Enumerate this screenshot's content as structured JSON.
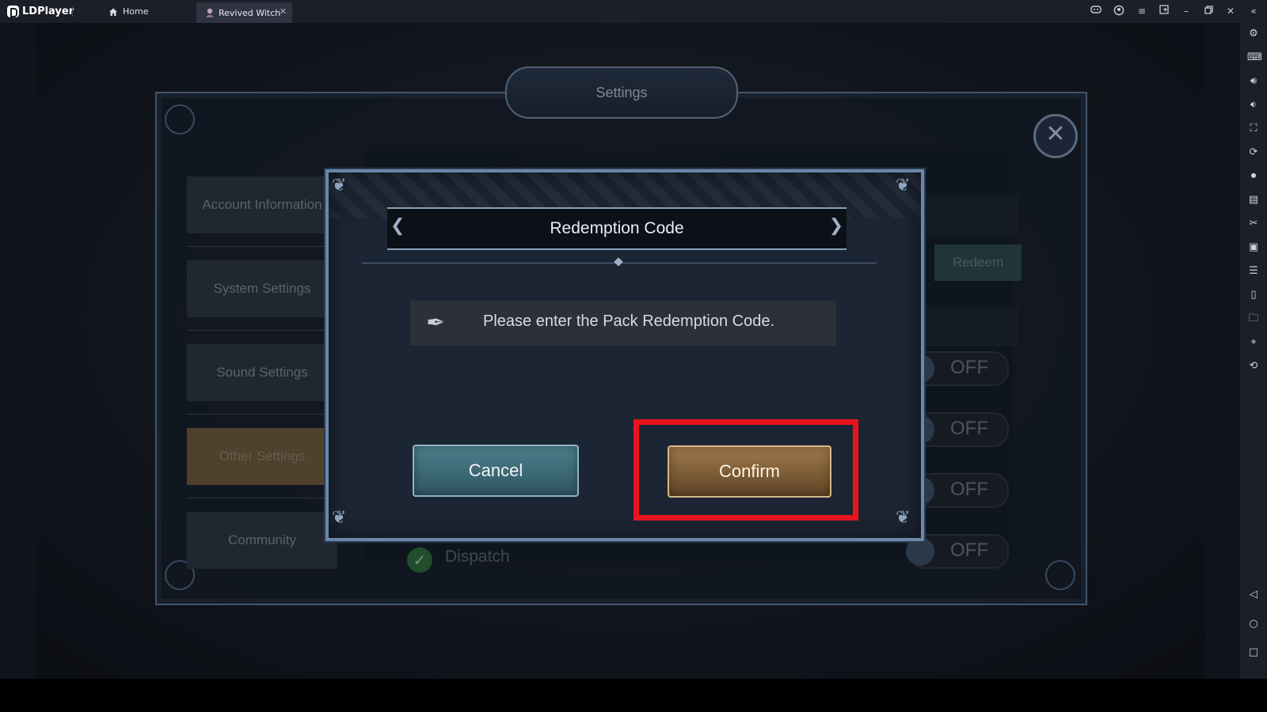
{
  "app": {
    "name": "LDPlayer",
    "tabs": [
      {
        "label": "Home",
        "icon": "home-icon"
      },
      {
        "label": "Revived Witch",
        "icon": "game-icon"
      }
    ],
    "window_controls": [
      "gamepad-icon",
      "account-icon",
      "menu-icon",
      "resize-icon",
      "minimize-icon",
      "restore-icon",
      "close-icon",
      "collapse-icon"
    ]
  },
  "sidebar": {
    "icons": [
      "settings-icon",
      "keyboard-icon",
      "volume-up-icon",
      "volume-down-icon",
      "screenshot-icon",
      "sync-icon",
      "record-icon",
      "apk-icon",
      "scissors-icon",
      "multi-instance-icon",
      "notes-icon",
      "shake-icon",
      "folder-icon",
      "location-icon",
      "rotate-icon"
    ],
    "nav_icons": [
      "back-icon",
      "home-circle-icon",
      "recents-icon"
    ]
  },
  "settings": {
    "title": "Settings",
    "close_label": "✕",
    "menu": [
      {
        "label": "Account Information",
        "active": false
      },
      {
        "label": "System Settings",
        "active": false
      },
      {
        "label": "Sound Settings",
        "active": false
      },
      {
        "label": "Other Settings",
        "active": true
      },
      {
        "label": "Community",
        "active": false
      }
    ],
    "redeem_label": "Redeem",
    "toggles": [
      "OFF",
      "OFF",
      "OFF",
      "OFF"
    ],
    "dispatch_label": "Dispatch"
  },
  "dialog": {
    "title": "Redemption Code",
    "input_placeholder": "Please enter the Pack Redemption Code.",
    "cancel_label": "Cancel",
    "confirm_label": "Confirm"
  },
  "colors": {
    "highlight": "#e8141c",
    "confirm": "#a07a4c",
    "cancel": "#4d7f8c",
    "active_menu": "#6e5a3f"
  }
}
